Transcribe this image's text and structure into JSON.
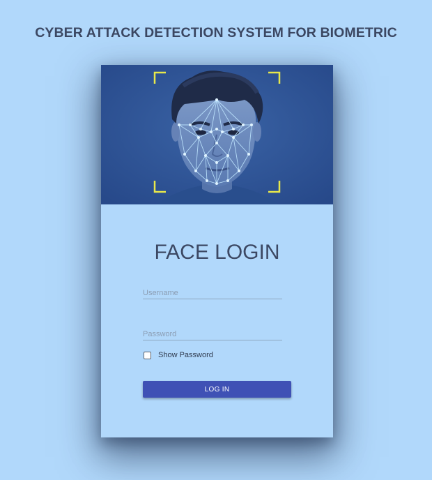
{
  "page": {
    "title": "CYBER ATTACK DETECTION SYSTEM FOR BIOMETRIC"
  },
  "login_form": {
    "title": "FACE LOGIN",
    "username_placeholder": "Username",
    "username_value": "",
    "password_placeholder": "Password",
    "password_value": "",
    "show_password_label": "Show Password",
    "show_password_checked": false,
    "login_button_label": "LOG IN"
  },
  "colors": {
    "background": "#b1d8fb",
    "title_text": "#3c4863",
    "hero_blue": "#2f5595",
    "scan_brackets": "#e8e84a",
    "face_mesh": "#bfe6ff",
    "button": "#3f51b5"
  }
}
